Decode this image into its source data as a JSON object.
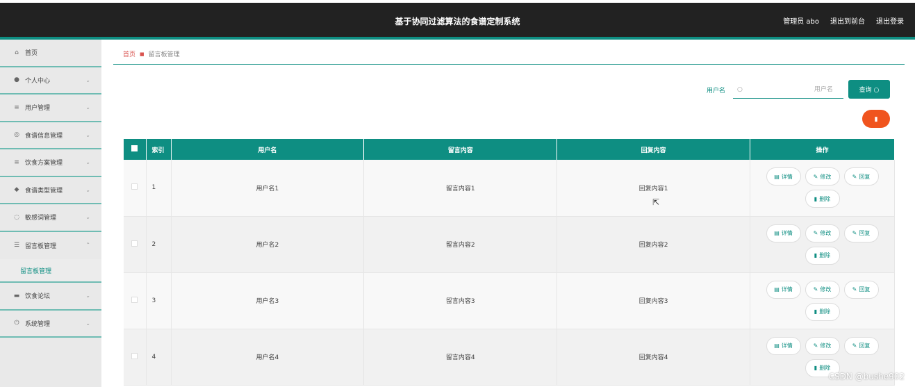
{
  "header": {
    "title": "基于协同过滤算法的食谱定制系统",
    "links": [
      "管理员 abo",
      "退出到前台",
      "退出登录"
    ]
  },
  "sidebar": {
    "items": [
      {
        "label": "首页",
        "icon": "home-icon",
        "glyph": "⌂",
        "chev": ""
      },
      {
        "label": "个人中心",
        "icon": "user-icon",
        "glyph": "●",
        "chev": "⌄"
      },
      {
        "label": "用户管理",
        "icon": "list-icon",
        "glyph": "≡",
        "chev": "⌄"
      },
      {
        "label": "食谱信息管理",
        "icon": "globe-icon",
        "glyph": "◎",
        "chev": "⌄"
      },
      {
        "label": "饮食方案管理",
        "icon": "list-icon",
        "glyph": "≡",
        "chev": "⌄"
      },
      {
        "label": "食谱类型管理",
        "icon": "pin-icon",
        "glyph": "◆",
        "chev": "⌄"
      },
      {
        "label": "敏感词管理",
        "icon": "compass-icon",
        "glyph": "◌",
        "chev": "⌄"
      },
      {
        "label": "留言板管理",
        "icon": "sliders-icon",
        "glyph": "☰",
        "chev": "⌃"
      }
    ],
    "submenu": "留言板管理",
    "items_after": [
      {
        "label": "饮食论坛",
        "icon": "chat-icon",
        "glyph": "▬",
        "chev": "⌄"
      },
      {
        "label": "系统管理",
        "icon": "power-icon",
        "glyph": "⏻",
        "chev": "⌄"
      }
    ]
  },
  "breadcrumb": {
    "home": "首页",
    "current": "留言板管理"
  },
  "search": {
    "label": "用户名",
    "placeholder": "用户名",
    "button": "查询"
  },
  "table": {
    "headers": [
      "索引",
      "用户名",
      "留言内容",
      "回复内容",
      "操作"
    ],
    "rows": [
      {
        "index": "1",
        "username": "用户名1",
        "message": "留言内容1",
        "reply": "回复内容1"
      },
      {
        "index": "2",
        "username": "用户名2",
        "message": "留言内容2",
        "reply": "回复内容2"
      },
      {
        "index": "3",
        "username": "用户名3",
        "message": "留言内容3",
        "reply": "回复内容3"
      },
      {
        "index": "4",
        "username": "用户名4",
        "message": "留言内容4",
        "reply": "回复内容4"
      }
    ],
    "actions": {
      "detail": "详情",
      "edit": "修改",
      "reply": "回复",
      "delete": "删除"
    }
  },
  "watermark": "CSDN @bushe902",
  "colors": {
    "accent": "#0e8e82",
    "danger": "#f0541e",
    "topbar": "#222222"
  }
}
